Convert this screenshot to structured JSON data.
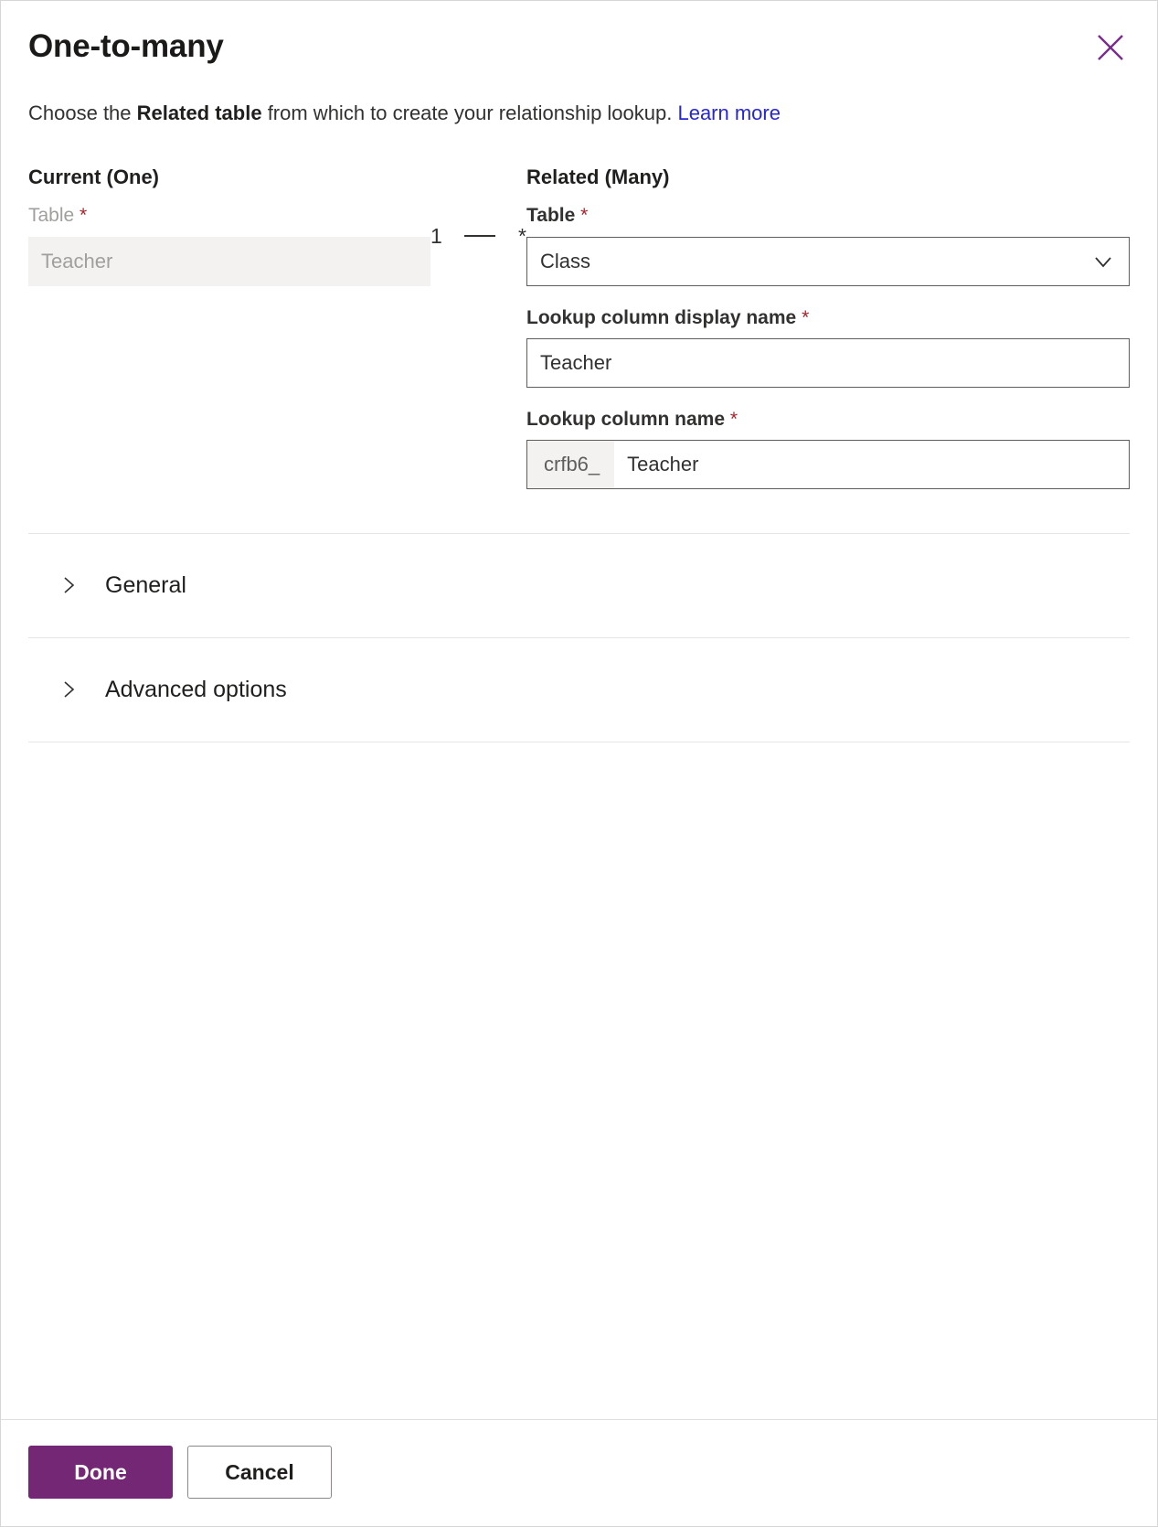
{
  "dialog": {
    "title": "One-to-many",
    "close_icon": "close-icon",
    "description": {
      "before": "Choose the ",
      "bold": "Related table",
      "after": " from which to create your relationship lookup. ",
      "link": "Learn more"
    }
  },
  "current": {
    "heading": "Current (One)",
    "table_label": "Table",
    "required_mark": "*",
    "table_value": "Teacher"
  },
  "connector": {
    "one": "1",
    "many": "*"
  },
  "related": {
    "heading": "Related (Many)",
    "table_label": "Table",
    "required_mark": "*",
    "table_value": "Class",
    "dropdown_icon": "chevron-down-icon",
    "display_name_label": "Lookup column display name",
    "display_name_value": "Teacher",
    "column_name_label": "Lookup column name",
    "column_name_prefix": "crfb6_",
    "column_name_value": "Teacher"
  },
  "sections": [
    {
      "label": "General",
      "icon": "chevron-right-icon",
      "expanded": false
    },
    {
      "label": "Advanced options",
      "icon": "chevron-right-icon",
      "expanded": false
    }
  ],
  "footer": {
    "done_label": "Done",
    "cancel_label": "Cancel"
  },
  "colors": {
    "accent": "#742774",
    "link": "#2626d6",
    "required": "#a4262c",
    "border": "#605e5c",
    "readonly_bg": "#f3f2f1",
    "divider": "#e6e5e4"
  }
}
